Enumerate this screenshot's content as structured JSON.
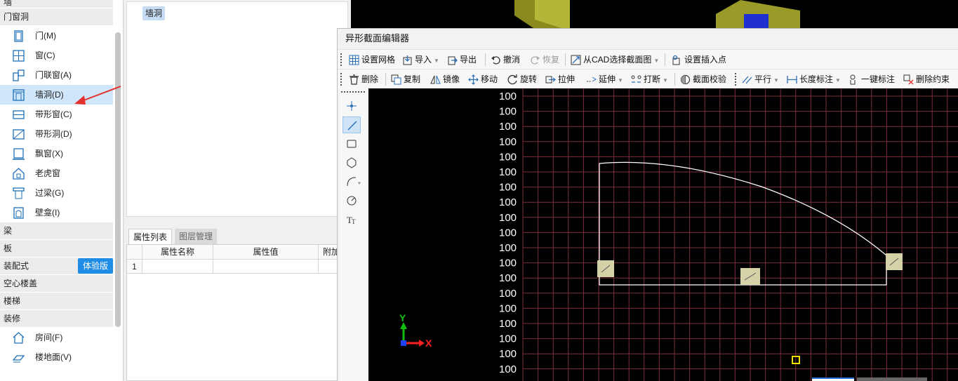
{
  "left_panel": {
    "top_partial": "墙",
    "categories_top": "门窗洞",
    "items": [
      {
        "label": "门(M)",
        "icon": "door-icon"
      },
      {
        "label": "窗(C)",
        "icon": "window-icon"
      },
      {
        "label": "门联窗(A)",
        "icon": "door-window-icon"
      },
      {
        "label": "墙洞(D)",
        "icon": "wall-opening-icon",
        "selected": true
      },
      {
        "label": "带形窗(C)",
        "icon": "strip-window-icon"
      },
      {
        "label": "带形洞(D)",
        "icon": "strip-opening-icon"
      },
      {
        "label": "飘窗(X)",
        "icon": "bay-window-icon"
      },
      {
        "label": "老虎窗",
        "icon": "dormer-window-icon"
      },
      {
        "label": "过梁(G)",
        "icon": "lintel-icon"
      },
      {
        "label": "壁龛(I)",
        "icon": "niche-icon"
      }
    ],
    "categories": [
      "梁",
      "板",
      "装配式",
      "空心楼盖",
      "楼梯",
      "装修"
    ],
    "badge": "体验版",
    "items_bottom": [
      {
        "label": "房间(F)",
        "icon": "room-icon"
      },
      {
        "label": "楼地面(V)",
        "icon": "floor-icon"
      }
    ]
  },
  "mid_panel": {
    "tag": "墙洞",
    "tabs": [
      "属性列表",
      "图层管理"
    ],
    "grid_headers": [
      "属性名称",
      "属性值",
      "附加"
    ],
    "row_number": "1"
  },
  "editor": {
    "title": "异形截面编辑器",
    "toolbar1": [
      {
        "label": "设置网格",
        "icon": "grid-icon"
      },
      {
        "label": "导入",
        "icon": "import-icon",
        "dropdown": true
      },
      {
        "label": "导出",
        "icon": "export-icon"
      },
      {
        "label": "撤消",
        "icon": "undo-icon"
      },
      {
        "label": "恢复",
        "icon": "redo-icon"
      },
      {
        "label": "从CAD选择截面图",
        "icon": "cad-select-icon",
        "dropdown": true
      },
      {
        "label": "设置插入点",
        "icon": "insert-point-icon"
      }
    ],
    "toolbar2": [
      {
        "label": "删除",
        "icon": "delete-icon"
      },
      {
        "label": "复制",
        "icon": "copy-icon"
      },
      {
        "label": "镜像",
        "icon": "mirror-icon"
      },
      {
        "label": "移动",
        "icon": "move-icon"
      },
      {
        "label": "旋转",
        "icon": "rotate-icon"
      },
      {
        "label": "拉伸",
        "icon": "stretch-icon"
      },
      {
        "label": "延伸",
        "icon": "extend-icon",
        "dropdown": true
      },
      {
        "label": "打断",
        "icon": "break-icon",
        "dropdown": true
      },
      {
        "label": "截面校验",
        "icon": "section-check-icon"
      },
      {
        "label": "平行",
        "icon": "parallel-icon",
        "dropdown": true
      },
      {
        "label": "长度标注",
        "icon": "length-dimension-icon",
        "dropdown": true
      },
      {
        "label": "一键标注",
        "icon": "auto-dimension-icon"
      },
      {
        "label": "删除约束",
        "icon": "delete-constraint-icon"
      }
    ],
    "grid_label": "100",
    "axis_x": "X",
    "axis_y": "Y",
    "colors": {
      "grid": "#7a2f3a",
      "shape": "#ffffff",
      "marker": "#d6d2a8",
      "axis_x": "#ff2020",
      "axis_y": "#10c010"
    }
  }
}
